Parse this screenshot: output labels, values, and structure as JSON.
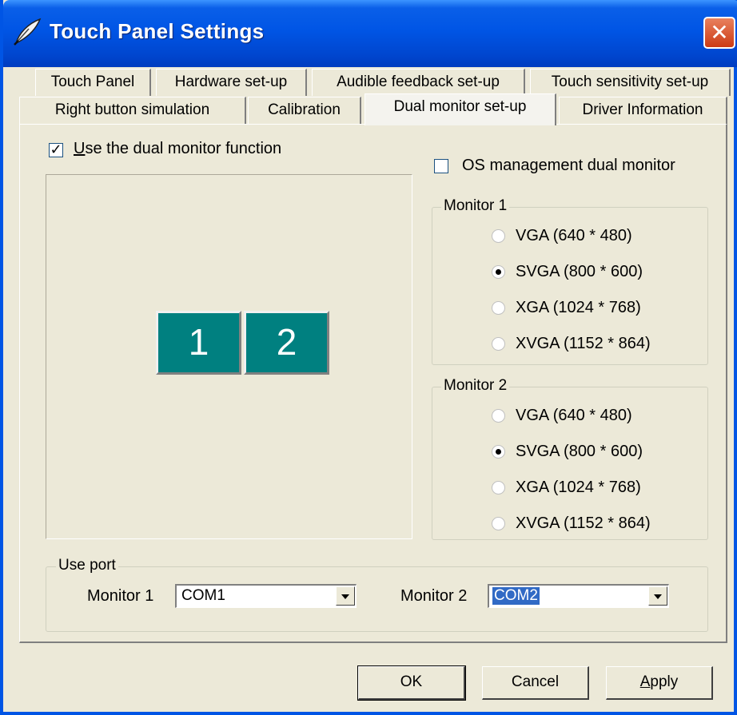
{
  "window": {
    "title": "Touch Panel Settings",
    "close_glyph": "✕"
  },
  "tabs": {
    "row1": [
      "Touch Panel",
      "Hardware set-up",
      "Audible feedback set-up",
      "Touch sensitivity set-up"
    ],
    "row2": [
      "Right button simulation",
      "Calibration",
      "Dual monitor set-up",
      "Driver Information"
    ],
    "active": "Dual monitor set-up"
  },
  "dual_monitor": {
    "use_function": {
      "label_prefix": "U",
      "label_rest": "se the dual monitor function",
      "checked": true
    },
    "os_management": {
      "label": "OS management dual monitor",
      "checked": false
    },
    "preview": {
      "tile1": "1",
      "tile2": "2"
    }
  },
  "monitor1": {
    "title": "Monitor 1",
    "options": [
      "VGA (640 * 480)",
      "SVGA (800 * 600)",
      "XGA (1024 * 768)",
      "XVGA (1152 * 864)"
    ],
    "selected": "SVGA (800 * 600)"
  },
  "monitor2": {
    "title": "Monitor 2",
    "options": [
      "VGA (640 * 480)",
      "SVGA (800 * 600)",
      "XGA (1024 * 768)",
      "XVGA (1152 * 864)"
    ],
    "selected": "SVGA (800 * 600)"
  },
  "use_port": {
    "title": "Use port",
    "monitor1_label": "Monitor 1",
    "monitor1_value": "COM1",
    "monitor2_label": "Monitor 2",
    "monitor2_value": "COM2"
  },
  "buttons": {
    "ok": "OK",
    "cancel": "Cancel",
    "apply_prefix": "A",
    "apply_rest": "pply"
  },
  "colors": {
    "titlebar": "#0055E5",
    "close": "#CC3A14",
    "monitor_tile": "#008080",
    "selection": "#316AC5"
  },
  "icons": {
    "title": "quill-pen-icon",
    "close": "close-icon",
    "dropdown": "chevron-down-icon"
  }
}
